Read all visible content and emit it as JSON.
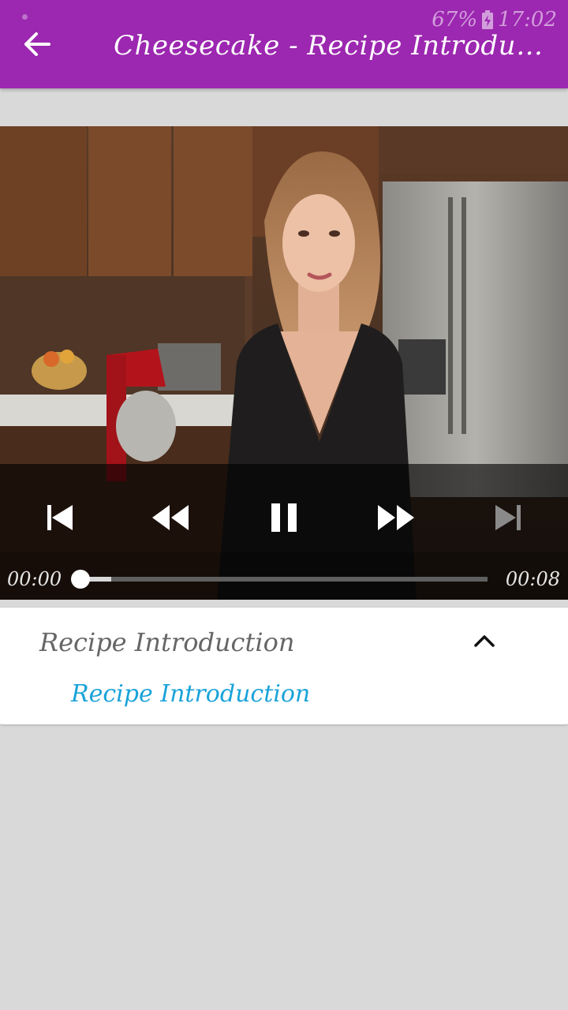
{
  "status_bar": {
    "battery": "67%",
    "time": "17:02"
  },
  "app_bar": {
    "title": "Cheesecake - Recipe Introdu…",
    "back_icon": "arrow-left-icon"
  },
  "player": {
    "current_time": "00:00",
    "total_time": "00:08",
    "progress": 0.08,
    "controls": [
      "skip-previous-icon",
      "rewind-icon",
      "pause-icon",
      "fast-forward-icon",
      "skip-next-icon"
    ]
  },
  "recipe_list": {
    "group_title": "Recipe Introduction",
    "expanded": true,
    "items": [
      {
        "label": "Recipe Introduction"
      }
    ]
  },
  "colors": {
    "app_bar": "#9c27b0",
    "link": "#1aa3d9",
    "background": "#d9d9d9"
  }
}
